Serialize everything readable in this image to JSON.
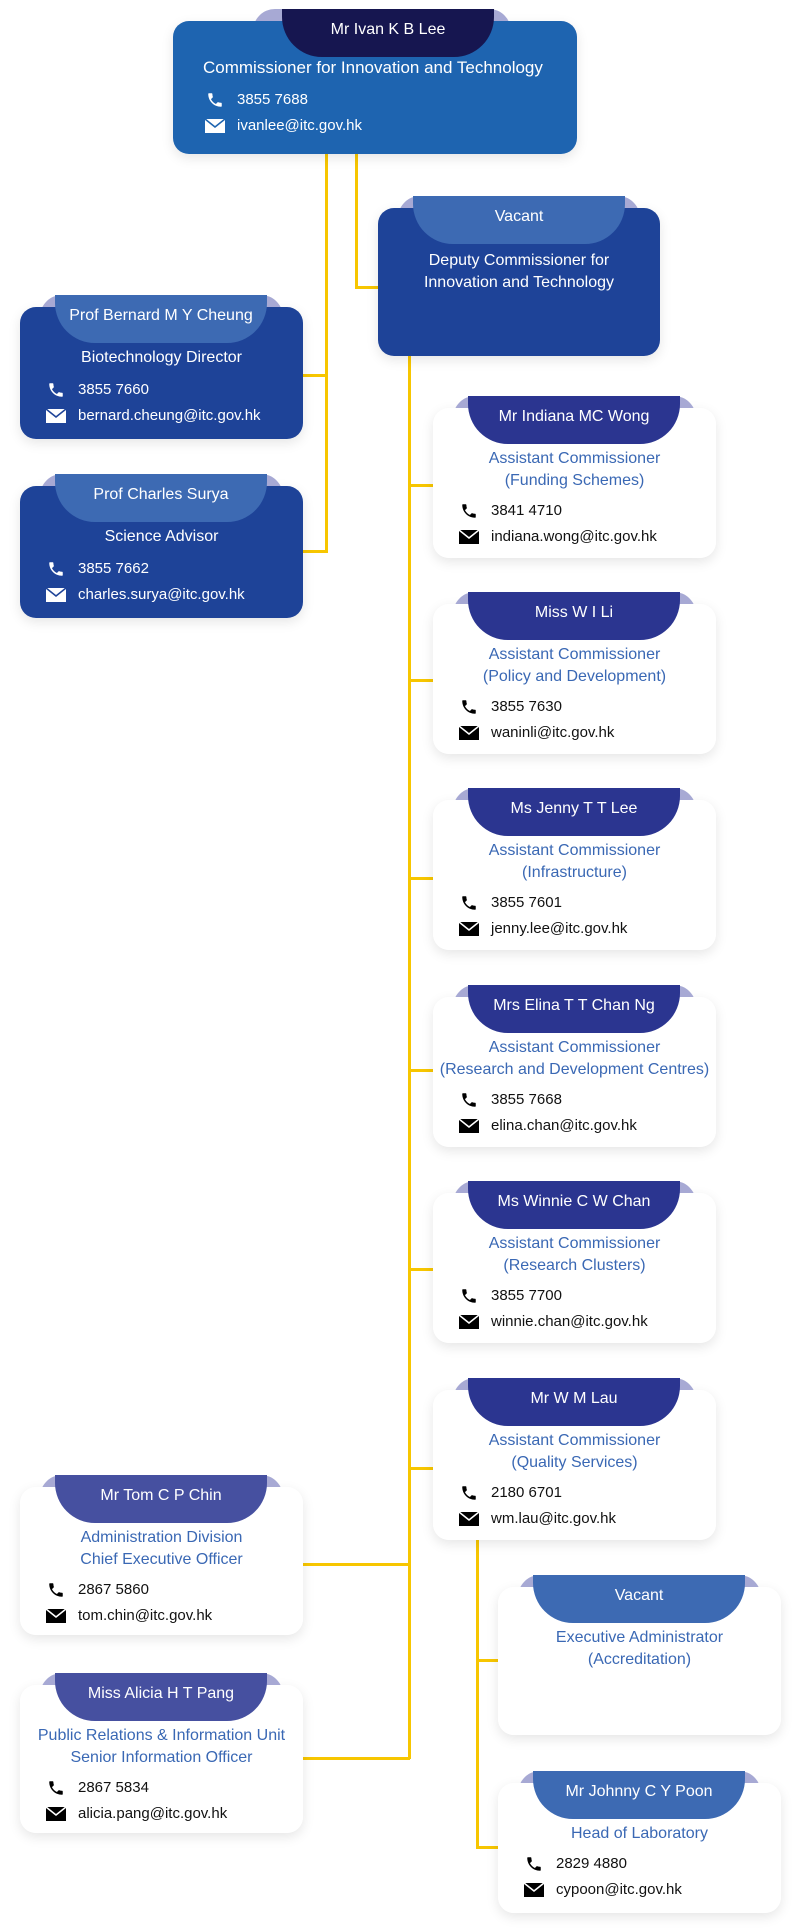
{
  "colors": {
    "connector": "#f7c600",
    "commissioner_body": "#1e64b0",
    "commissioner_pill": "#161650",
    "directorate_body": "#1e4398",
    "directorate_pill": "#3d6ab3",
    "assistant_pill": "#2b3590",
    "admin_pill": "#4650a0",
    "sub_pill": "#3d6ab3",
    "title_blue": "#3a68b4"
  },
  "commissioner": {
    "name": "Mr Ivan K B Lee",
    "title": "Commissioner for Innovation and Technology",
    "phone": "3855 7688",
    "email": "ivanlee@itc.gov.hk"
  },
  "deputy": {
    "name": "Vacant",
    "title_line1": "Deputy Commissioner for",
    "title_line2": "Innovation and Technology"
  },
  "advisors": [
    {
      "name": "Prof Bernard M Y Cheung",
      "title": "Biotechnology Director",
      "phone": "3855 7660",
      "email": "bernard.cheung@itc.gov.hk"
    },
    {
      "name": "Prof Charles Surya",
      "title": "Science Advisor",
      "phone": "3855 7662",
      "email": "charles.surya@itc.gov.hk"
    }
  ],
  "assistants": [
    {
      "name": "Mr Indiana MC Wong",
      "title_line1": "Assistant Commissioner",
      "title_line2": "(Funding Schemes)",
      "phone": "3841 4710",
      "email": "indiana.wong@itc.gov.hk"
    },
    {
      "name": "Miss W I Li",
      "title_line1": "Assistant Commissioner",
      "title_line2": "(Policy and Development)",
      "phone": "3855 7630",
      "email": "waninli@itc.gov.hk"
    },
    {
      "name": "Ms Jenny T T Lee",
      "title_line1": "Assistant Commissioner",
      "title_line2": "(Infrastructure)",
      "phone": "3855 7601",
      "email": "jenny.lee@itc.gov.hk"
    },
    {
      "name": "Mrs Elina T T Chan Ng",
      "title_line1": "Assistant Commissioner",
      "title_line2": "(Research and Development Centres)",
      "phone": "3855 7668",
      "email": "elina.chan@itc.gov.hk"
    },
    {
      "name": "Ms Winnie C W Chan",
      "title_line1": "Assistant Commissioner",
      "title_line2": "(Research Clusters)",
      "phone": "3855 7700",
      "email": "winnie.chan@itc.gov.hk"
    },
    {
      "name": "Mr W M Lau",
      "title_line1": "Assistant Commissioner",
      "title_line2": "(Quality Services)",
      "phone": "2180 6701",
      "email": "wm.lau@itc.gov.hk"
    }
  ],
  "admin": [
    {
      "name": "Mr Tom C P Chin",
      "title_line1": "Administration Division",
      "title_line2": "Chief Executive Officer",
      "phone": "2867 5860",
      "email": "tom.chin@itc.gov.hk"
    },
    {
      "name": "Miss Alicia H T Pang",
      "title_line1": "Public Relations & Information Unit",
      "title_line2": "Senior Information Officer",
      "phone": "2867 5834",
      "email": "alicia.pang@itc.gov.hk"
    }
  ],
  "quality_sub": [
    {
      "name": "Vacant",
      "title_line1": "Executive Administrator",
      "title_line2": "(Accreditation)"
    },
    {
      "name": "Mr Johnny C Y Poon",
      "title_line1": "Head of Laboratory",
      "phone": "2829 4880",
      "email": "cypoon@itc.gov.hk"
    }
  ]
}
